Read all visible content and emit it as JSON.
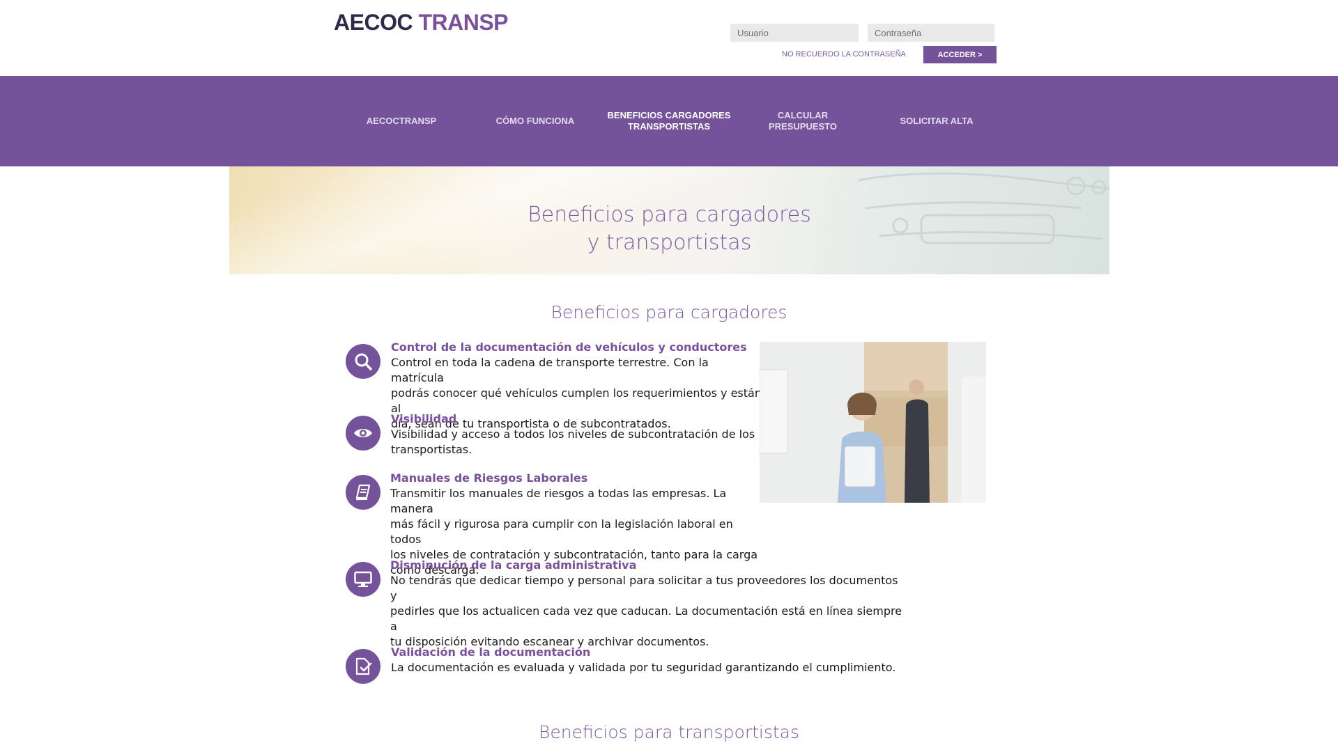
{
  "header": {
    "logo_part1": "AECOC",
    "logo_part2": "TRANSP",
    "user_placeholder": "Usuario",
    "password_placeholder": "Contraseña",
    "forgot_label": "NO RECUERDO LA CONTRASEÑA",
    "login_button": "ACCEDER >"
  },
  "nav": {
    "items": [
      {
        "line1": "AECOCTRANSP",
        "line2": ""
      },
      {
        "line1": "CÓMO FUNCIONA",
        "line2": ""
      },
      {
        "line1": "BENEFICIOS CARGADORES",
        "line2": "TRANSPORTISTAS"
      },
      {
        "line1": "CALCULAR",
        "line2": "PRESUPUESTO"
      },
      {
        "line1": "SOLICITAR ALTA",
        "line2": ""
      }
    ]
  },
  "banner": {
    "title_line1": "Beneficios para cargadores",
    "title_line2": "y transportistas"
  },
  "cargadores": {
    "section_title": "Beneficios para cargadores",
    "items": [
      {
        "icon": "search-icon",
        "title": "Control de la documentación de vehículos y conductores",
        "lines": [
          "Control en toda la cadena de transporte terrestre. Con la matrícula",
          "podrás conocer qué vehículos cumplen los requerimientos y están al",
          "día, sean de tu transportista o de subcontratados."
        ]
      },
      {
        "icon": "eye-icon",
        "title": "Visibilidad",
        "lines": [
          "Visibilidad y acceso a todos los niveles de subcontratación de los",
          "transportistas."
        ]
      },
      {
        "icon": "book-icon",
        "title": "Manuales de Riesgos Laborales",
        "lines": [
          "Transmitir los manuales de riesgos a todas las empresas. La manera",
          "más fácil y rigurosa para cumplir con la legislación laboral en todos",
          "los niveles de contratación y subcontratación, tanto para la carga",
          "como descarga."
        ]
      },
      {
        "icon": "monitor-icon",
        "title": "Disminución de la carga administrativa",
        "lines": [
          "No tendrás que dedicar tiempo y personal para solicitar a tus proveedores los documentos y",
          "pedirles que los actualicen cada vez que caducan. La documentación está en línea siempre a",
          "tu disposición evitando escanear y archivar documentos."
        ]
      },
      {
        "icon": "document-check-icon",
        "title": "Validación de la documentación",
        "lines": [
          "La documentación es evaluada y validada por tu seguridad garantizando el cumplimiento."
        ]
      }
    ]
  },
  "transportistas": {
    "section_title": "Beneficios para transportistas"
  },
  "colors": {
    "brand_purple": "#74539a",
    "title_purple": "#7a5aa2",
    "logo_dark": "#2c2c4a"
  }
}
